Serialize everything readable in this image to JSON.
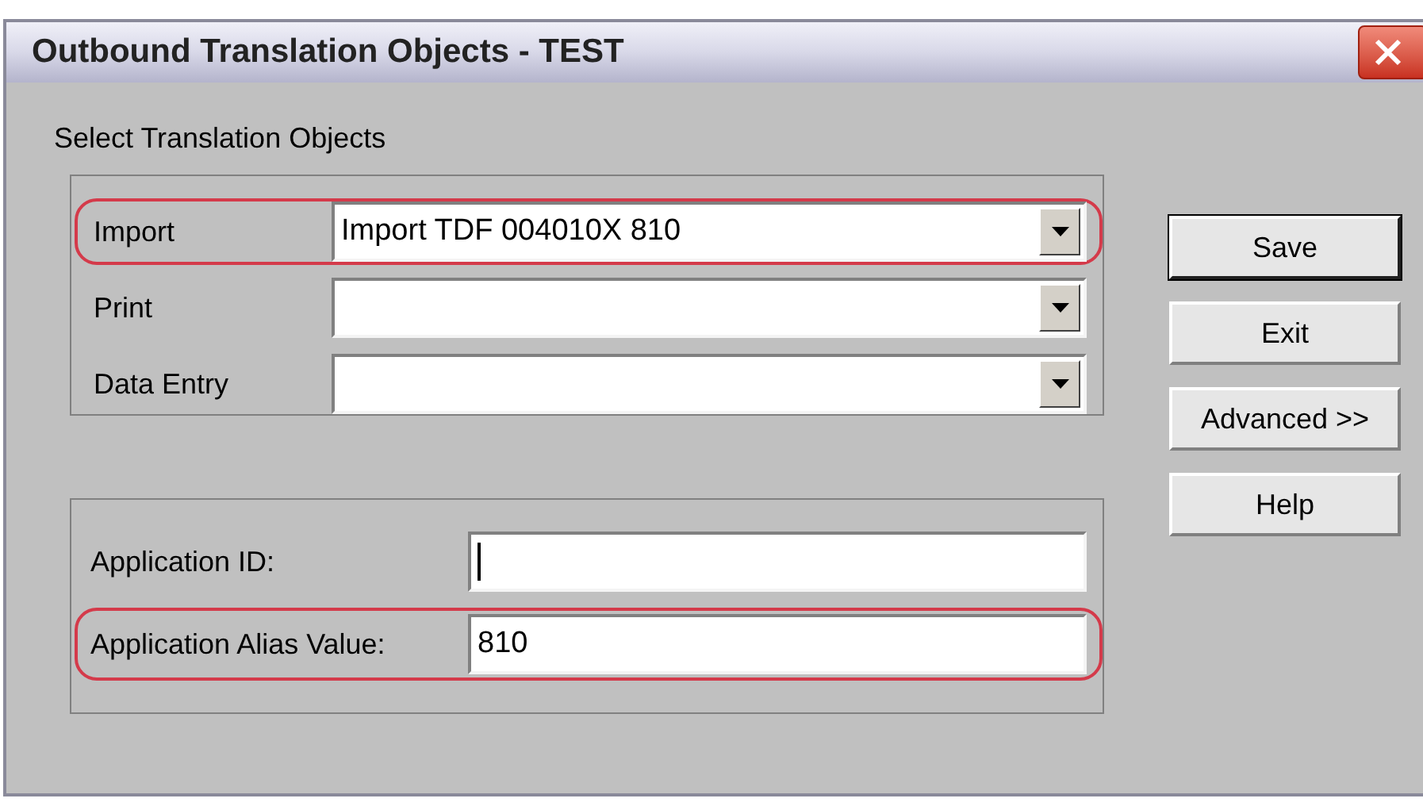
{
  "window": {
    "title": "Outbound Translation Objects - TEST"
  },
  "translation_objects": {
    "heading": "Select Translation Objects",
    "rows": [
      {
        "label": "Import",
        "value": "Import TDF 004010X 810",
        "highlighted": true
      },
      {
        "label": "Print",
        "highlighted": false
      },
      {
        "label": "Data Entry",
        "highlighted": false
      }
    ]
  },
  "application": {
    "fields": [
      {
        "label": "Application ID:",
        "focused": true,
        "highlighted": false
      },
      {
        "label": "Application Alias Value:",
        "value": "810",
        "focused": false,
        "highlighted": true
      }
    ]
  },
  "buttons": [
    {
      "label": "Save",
      "default": true
    },
    {
      "label": "Exit",
      "default": false
    },
    {
      "label": "Advanced >>",
      "default": false
    },
    {
      "label": "Help",
      "default": false
    }
  ]
}
